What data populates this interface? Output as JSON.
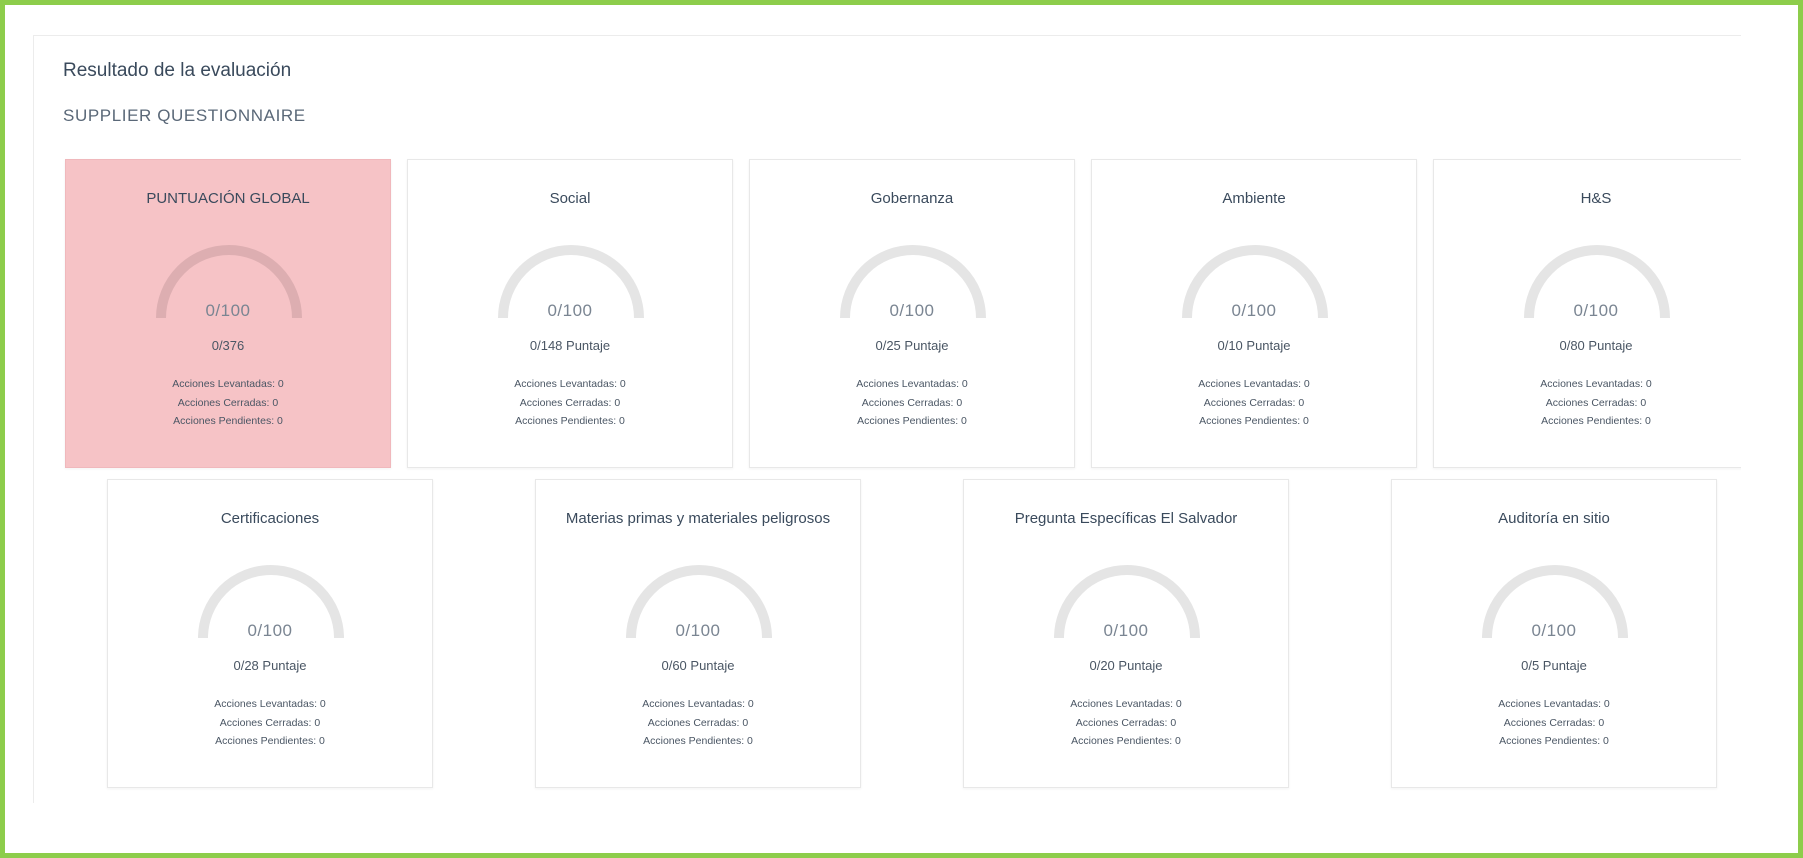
{
  "header": {
    "title": "Resultado de la evaluación",
    "subtitle": "SUPPLIER QUESTIONNAIRE"
  },
  "colors": {
    "highlight_card": "#f6c3c6",
    "frame_border": "#8dcd4b",
    "gauge_track": "#e5e5e5"
  },
  "cards": [
    {
      "title": "PUNTUACIÓN GLOBAL",
      "gauge_label": "0/100",
      "gauge_percent": 0,
      "score": "0/376",
      "raised": "Acciones Levantadas: 0",
      "closed": "Acciones Cerradas: 0",
      "pending": "Acciones Pendientes: 0"
    },
    {
      "title": "Social",
      "gauge_label": "0/100",
      "gauge_percent": 0,
      "score": "0/148 Puntaje",
      "raised": "Acciones Levantadas: 0",
      "closed": "Acciones Cerradas: 0",
      "pending": "Acciones Pendientes: 0"
    },
    {
      "title": "Gobernanza",
      "gauge_label": "0/100",
      "gauge_percent": 0,
      "score": "0/25 Puntaje",
      "raised": "Acciones Levantadas: 0",
      "closed": "Acciones Cerradas: 0",
      "pending": "Acciones Pendientes: 0"
    },
    {
      "title": "Ambiente",
      "gauge_label": "0/100",
      "gauge_percent": 0,
      "score": "0/10 Puntaje",
      "raised": "Acciones Levantadas: 0",
      "closed": "Acciones Cerradas: 0",
      "pending": "Acciones Pendientes: 0"
    },
    {
      "title": "H&S",
      "gauge_label": "0/100",
      "gauge_percent": 0,
      "score": "0/80 Puntaje",
      "raised": "Acciones Levantadas: 0",
      "closed": "Acciones Cerradas: 0",
      "pending": "Acciones Pendientes: 0"
    },
    {
      "title": "Certificaciones",
      "gauge_label": "0/100",
      "gauge_percent": 0,
      "score": "0/28 Puntaje",
      "raised": "Acciones Levantadas: 0",
      "closed": "Acciones Cerradas: 0",
      "pending": "Acciones Pendientes: 0"
    },
    {
      "title": "Materias primas y materiales peligrosos",
      "gauge_label": "0/100",
      "gauge_percent": 0,
      "score": "0/60 Puntaje",
      "raised": "Acciones Levantadas: 0",
      "closed": "Acciones Cerradas: 0",
      "pending": "Acciones Pendientes: 0"
    },
    {
      "title": "Pregunta Específicas El Salvador",
      "gauge_label": "0/100",
      "gauge_percent": 0,
      "score": "0/20 Puntaje",
      "raised": "Acciones Levantadas: 0",
      "closed": "Acciones Cerradas: 0",
      "pending": "Acciones Pendientes: 0"
    },
    {
      "title": "Auditoría en sitio",
      "gauge_label": "0/100",
      "gauge_percent": 0,
      "score": "0/5 Puntaje",
      "raised": "Acciones Levantadas: 0",
      "closed": "Acciones Cerradas: 0",
      "pending": "Acciones Pendientes: 0"
    }
  ]
}
